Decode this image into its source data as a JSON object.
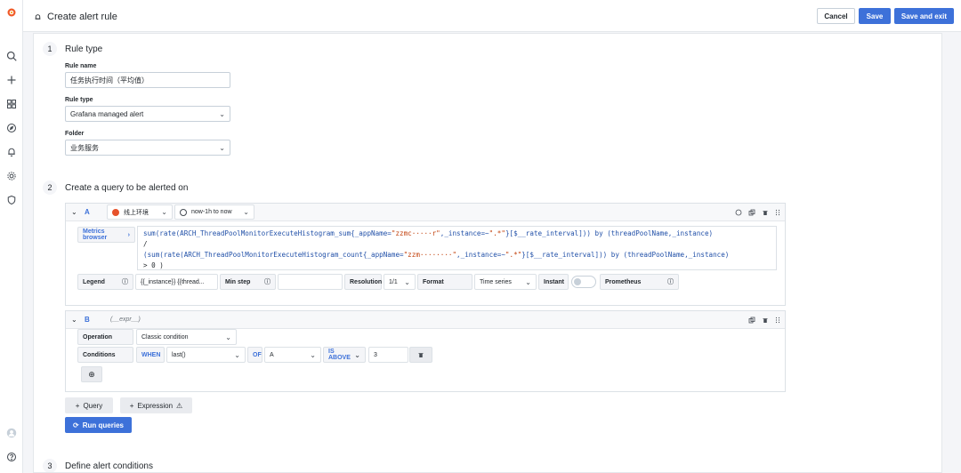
{
  "header": {
    "title": "Create alert rule",
    "cancel": "Cancel",
    "save": "Save",
    "save_exit": "Save and exit"
  },
  "step1": {
    "num": "1",
    "title": "Rule type",
    "rule_name_label": "Rule name",
    "rule_name_value": "任务执行时间（平均值）",
    "rule_type_label": "Rule type",
    "rule_type_value": "Grafana managed alert",
    "folder_label": "Folder",
    "folder_value": "业务服务"
  },
  "step2": {
    "num": "2",
    "title": "Create a query to be alerted on",
    "queryA": {
      "letter": "A",
      "datasource": "线上环境",
      "time_range": "now-1h to now",
      "metrics_browser": "Metrics browser",
      "legend_label": "Legend",
      "legend_value": "{{_instance}} {{thread...",
      "min_step_label": "Min step",
      "min_step_value": "",
      "resolution_label": "Resolution",
      "resolution_value": "1/1",
      "format_label": "Format",
      "format_value": "Time series",
      "instant_label": "Instant",
      "prometheus_label": "Prometheus"
    },
    "queryB": {
      "letter": "B",
      "expr_hint": "(__expr__)",
      "operation_label": "Operation",
      "operation_value": "Classic condition",
      "conditions_label": "Conditions",
      "when": "WHEN",
      "func": "last()",
      "of": "OF",
      "of_value": "A",
      "is_above": "IS ABOVE",
      "threshold": "3"
    },
    "add_query": "Query",
    "add_expression": "Expression",
    "run_queries": "Run queries"
  },
  "step3": {
    "num": "3",
    "title": "Define alert conditions"
  },
  "colors": {
    "primary": "#3d71d9",
    "accent": "#f05a28"
  }
}
